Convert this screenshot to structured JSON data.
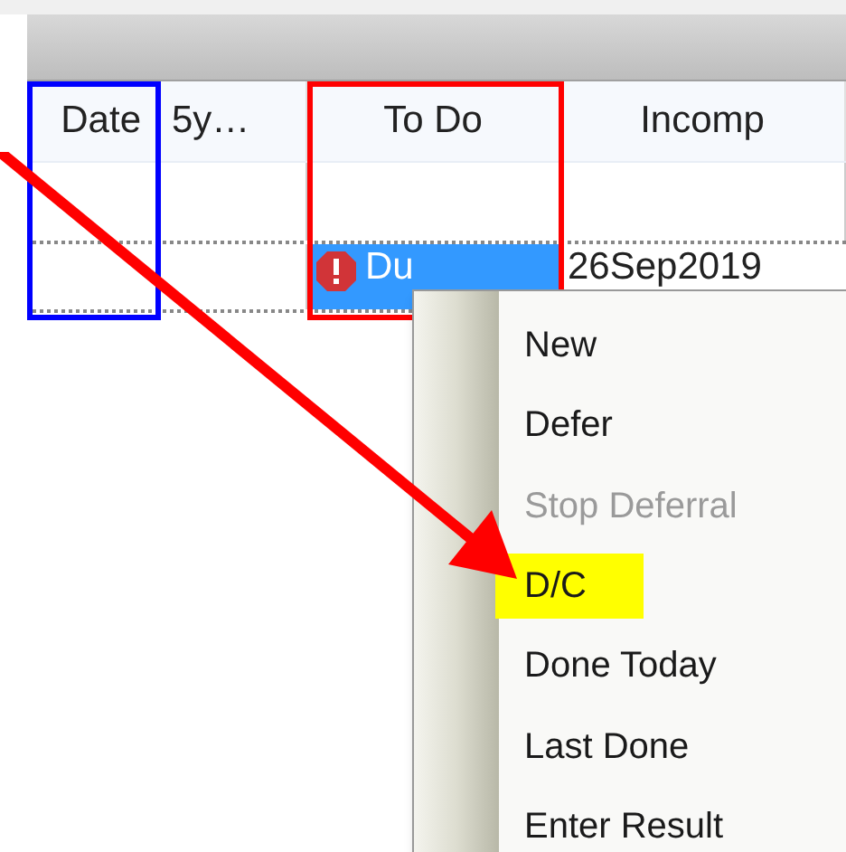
{
  "table": {
    "columns": [
      {
        "label": "Date",
        "color": "#0000ff"
      },
      {
        "label": "5y…"
      },
      {
        "label": "To Do",
        "color": "#ff0000"
      },
      {
        "label": "Incomp"
      }
    ],
    "rows": [
      {
        "cells": [
          "",
          "",
          "",
          ""
        ]
      },
      {
        "cells": [
          "",
          "",
          {
            "text": "Du",
            "selected": true
          },
          "26Sep2019"
        ]
      }
    ]
  },
  "context_menu": {
    "items": [
      {
        "label": "New",
        "disabled": false,
        "highlighted": false
      },
      {
        "label": "Defer",
        "disabled": false,
        "highlighted": false
      },
      {
        "label": "Stop Deferral",
        "disabled": true,
        "highlighted": false
      },
      {
        "label": "D/C",
        "disabled": false,
        "highlighted": true
      },
      {
        "label": "Done Today",
        "disabled": false,
        "highlighted": false
      },
      {
        "label": "Last Done",
        "disabled": false,
        "highlighted": false
      },
      {
        "label": "Enter Result",
        "disabled": false,
        "highlighted": false
      }
    ]
  }
}
